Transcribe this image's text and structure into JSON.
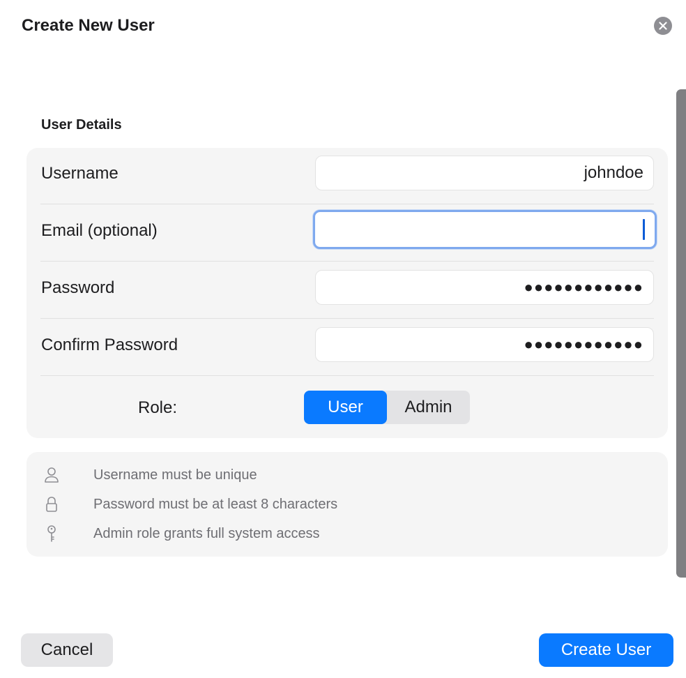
{
  "dialog": {
    "title": "Create New User"
  },
  "section": {
    "title": "User Details"
  },
  "fields": {
    "username": {
      "label": "Username",
      "value": "johndoe"
    },
    "email": {
      "label": "Email (optional)",
      "value": ""
    },
    "password": {
      "label": "Password",
      "value": "●●●●●●●●●●●●"
    },
    "confirm_password": {
      "label": "Confirm Password",
      "value": "●●●●●●●●●●●●"
    }
  },
  "role": {
    "label": "Role:",
    "options": [
      "User",
      "Admin"
    ],
    "selected": "User"
  },
  "hints": [
    {
      "icon": "person-icon",
      "text": "Username must be unique"
    },
    {
      "icon": "lock-icon",
      "text": "Password must be at least 8 characters"
    },
    {
      "icon": "key-icon",
      "text": "Admin role grants full system access"
    }
  ],
  "buttons": {
    "cancel": "Cancel",
    "create": "Create User"
  },
  "colors": {
    "accent": "#0a7aff",
    "focus_ring": "#7fa9ee",
    "card_bg": "#f5f5f5",
    "hint_text": "#6e6e73"
  }
}
